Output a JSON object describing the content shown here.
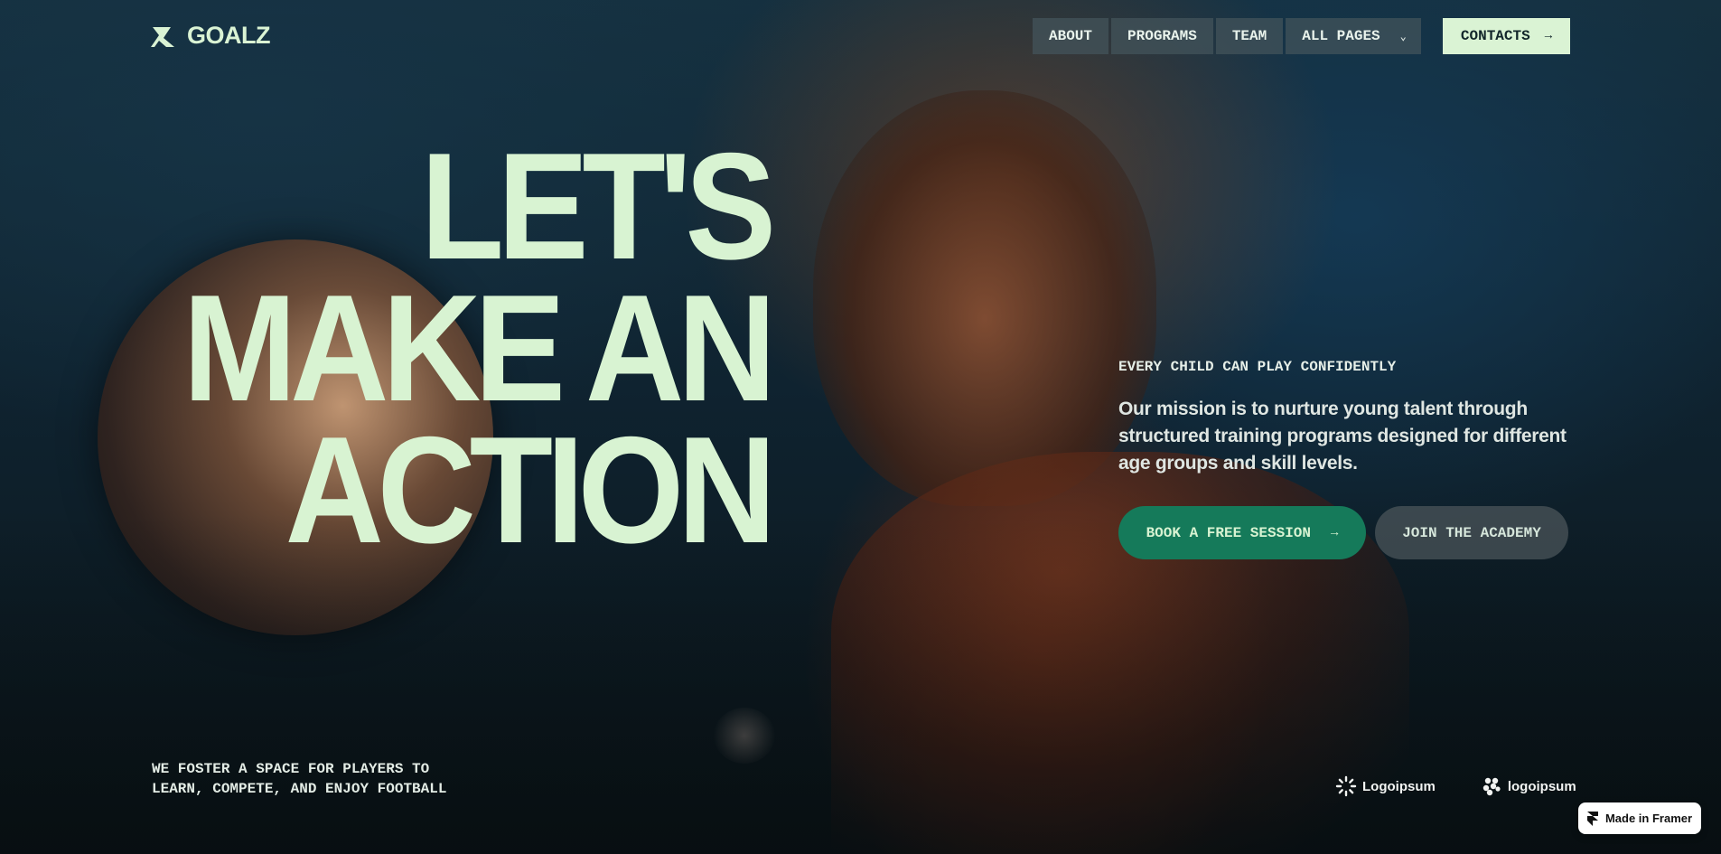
{
  "brand": {
    "name": "GOALZ"
  },
  "nav": {
    "links": [
      "ABOUT",
      "PROGRAMS",
      "TEAM"
    ],
    "dropdown_label": "ALL PAGES",
    "contacts_label": "CONTACTS"
  },
  "hero": {
    "headline": [
      "LET'S",
      "MAKE AN",
      "ACTION"
    ],
    "eyebrow": "EVERY CHILD CAN PLAY CONFIDENTLY",
    "mission": "Our mission is to nurture young talent through structured training programs designed for different age groups and skill levels.",
    "primary_cta": "BOOK A FREE SESSION",
    "secondary_cta": "JOIN THE ACADEMY"
  },
  "footer": {
    "tagline_lines": [
      "WE FOSTER A SPACE FOR PLAYERS TO",
      "LEARN, COMPETE, AND ENJOY FOOTBALL"
    ],
    "partners": [
      "Logoipsum",
      "logoipsum"
    ]
  },
  "badge": {
    "label": "Made in Framer"
  },
  "colors": {
    "accent_mint": "#daf3d4",
    "cta_green": "#157a5a",
    "background": "#0b1419"
  },
  "icons": [
    "brand-mark-icon",
    "chevron-down-icon",
    "arrow-right-icon",
    "partner-sun-icon",
    "partner-cluster-icon",
    "framer-icon"
  ]
}
